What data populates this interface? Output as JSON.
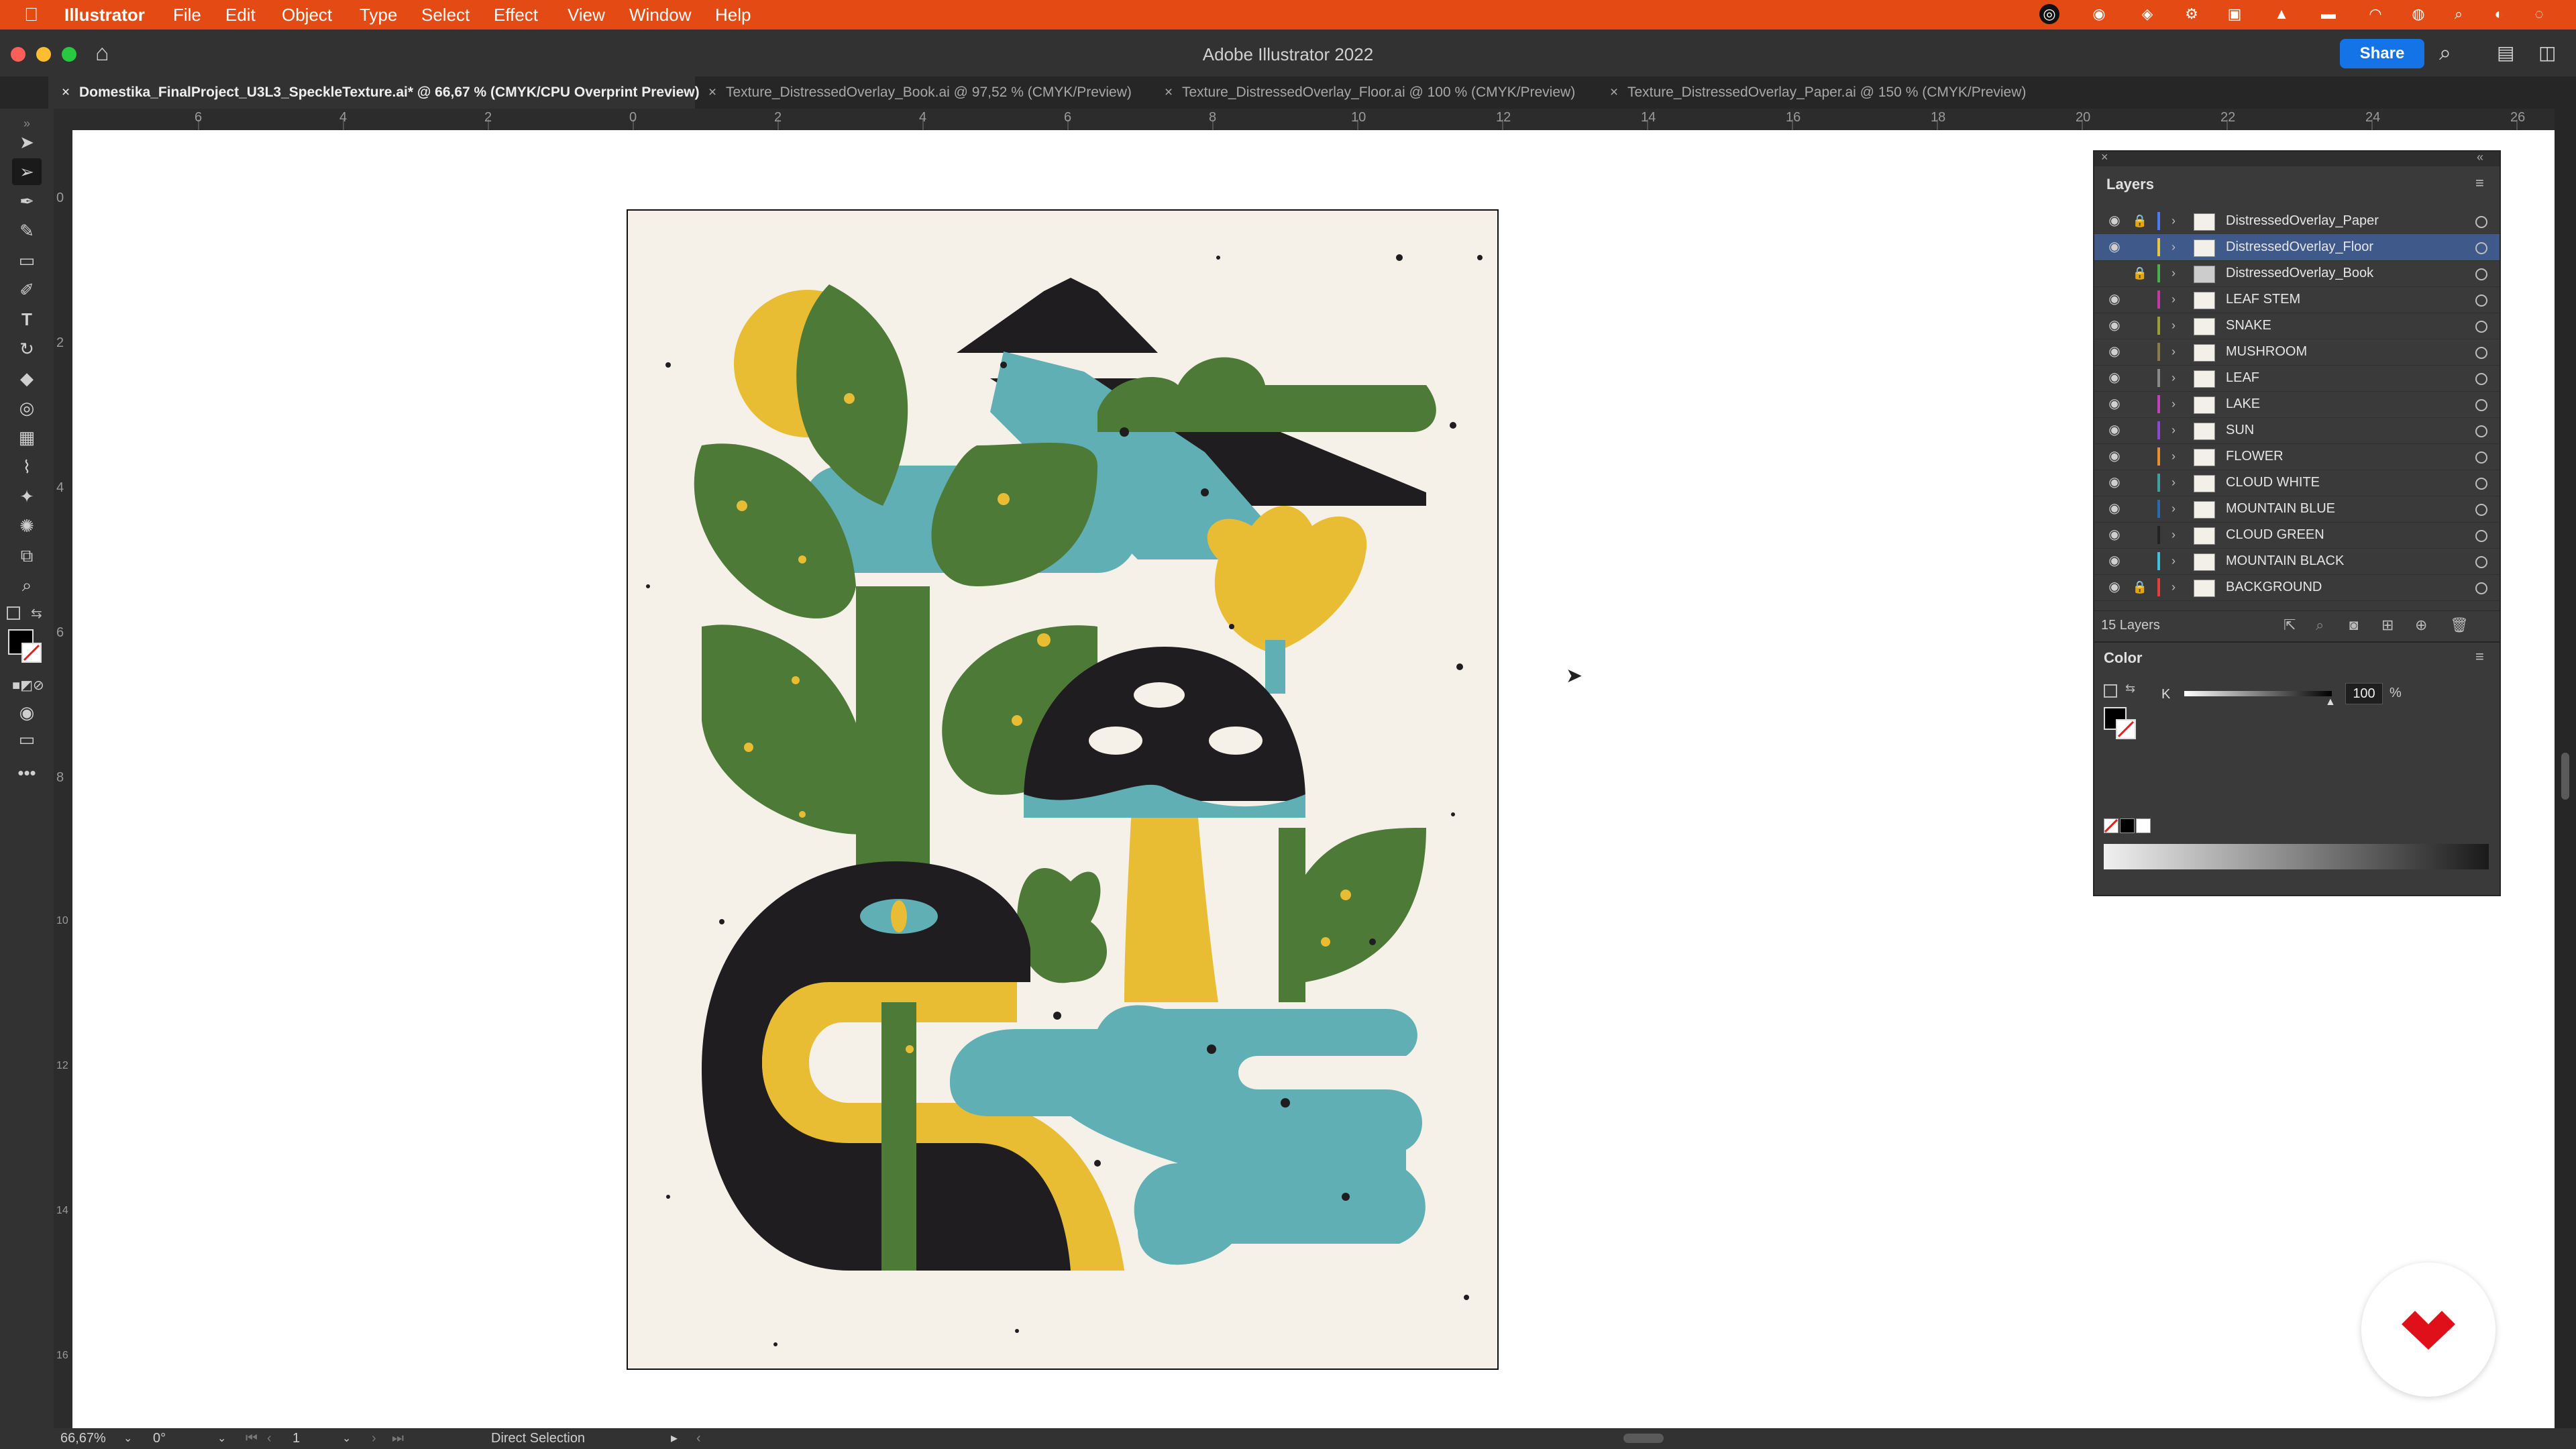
{
  "menubar": {
    "app_name": "Illustrator",
    "items": [
      "File",
      "Edit",
      "Object",
      "Type",
      "Select",
      "Effect",
      "View",
      "Window",
      "Help"
    ]
  },
  "window": {
    "title": "Adobe Illustrator 2022",
    "share_label": "Share"
  },
  "tabs": [
    {
      "label": "Domestika_FinalProject_U3L3_SpeckleTexture.ai* @ 66,67 % (CMYK/CPU Overprint Preview)",
      "active": true
    },
    {
      "label": "Texture_DistressedOverlay_Book.ai @ 97,52 % (CMYK/Preview)",
      "active": false
    },
    {
      "label": "Texture_DistressedOverlay_Floor.ai @ 100 % (CMYK/Preview)",
      "active": false
    },
    {
      "label": "Texture_DistressedOverlay_Paper.ai @ 150 % (CMYK/Preview)",
      "active": false
    }
  ],
  "ruler": {
    "h_labels": [
      "6",
      "4",
      "2",
      "0",
      "2",
      "4",
      "6",
      "8",
      "10",
      "12",
      "14",
      "16",
      "18",
      "20",
      "22",
      "24",
      "26"
    ],
    "v_labels": [
      "0",
      "2",
      "4",
      "6",
      "8",
      "10",
      "12",
      "14",
      "16"
    ]
  },
  "layers_panel": {
    "title": "Layers",
    "count_label": "15 Layers",
    "layers": [
      {
        "name": "DistressedOverlay_Paper",
        "color": "#4a7df0",
        "locked": true,
        "visible": true,
        "selected": false
      },
      {
        "name": "DistressedOverlay_Floor",
        "color": "#e8c740",
        "locked": false,
        "visible": true,
        "selected": true
      },
      {
        "name": "DistressedOverlay_Book",
        "color": "#4ab04a",
        "locked": true,
        "visible": false,
        "selected": false
      },
      {
        "name": "LEAF STEM",
        "color": "#c03aa0",
        "locked": false,
        "visible": true,
        "selected": false
      },
      {
        "name": "SNAKE",
        "color": "#9aa038",
        "locked": false,
        "visible": true,
        "selected": false
      },
      {
        "name": "MUSHROOM",
        "color": "#8a7a50",
        "locked": false,
        "visible": true,
        "selected": false
      },
      {
        "name": "LEAF",
        "color": "#8a8a8a",
        "locked": false,
        "visible": true,
        "selected": false
      },
      {
        "name": "LAKE",
        "color": "#c040c0",
        "locked": false,
        "visible": true,
        "selected": false
      },
      {
        "name": "SUN",
        "color": "#8a4ad0",
        "locked": false,
        "visible": true,
        "selected": false
      },
      {
        "name": "FLOWER",
        "color": "#e89030",
        "locked": false,
        "visible": true,
        "selected": false
      },
      {
        "name": "CLOUD WHITE",
        "color": "#40a0a0",
        "locked": false,
        "visible": true,
        "selected": false
      },
      {
        "name": "MOUNTAIN BLUE",
        "color": "#2a6ab0",
        "locked": false,
        "visible": true,
        "selected": false
      },
      {
        "name": "CLOUD GREEN",
        "color": "#222222",
        "locked": false,
        "visible": true,
        "selected": false
      },
      {
        "name": "MOUNTAIN BLACK",
        "color": "#40c0e0",
        "locked": false,
        "visible": true,
        "selected": false
      },
      {
        "name": "BACKGROUND",
        "color": "#e04040",
        "locked": true,
        "visible": true,
        "selected": false
      }
    ]
  },
  "color_panel": {
    "title": "Color",
    "channel_label": "K",
    "k_value": "100",
    "unit": "%"
  },
  "status_bar": {
    "zoom": "66,67%",
    "rotation": "0°",
    "artboard": "1",
    "tool": "Direct Selection"
  },
  "colors": {
    "menubar": "#e44b14",
    "cream": "#f5f1e8",
    "green": "#4e7a38",
    "teal": "#5fafb5",
    "yellow": "#e8bc33",
    "black": "#1f1d1f"
  }
}
